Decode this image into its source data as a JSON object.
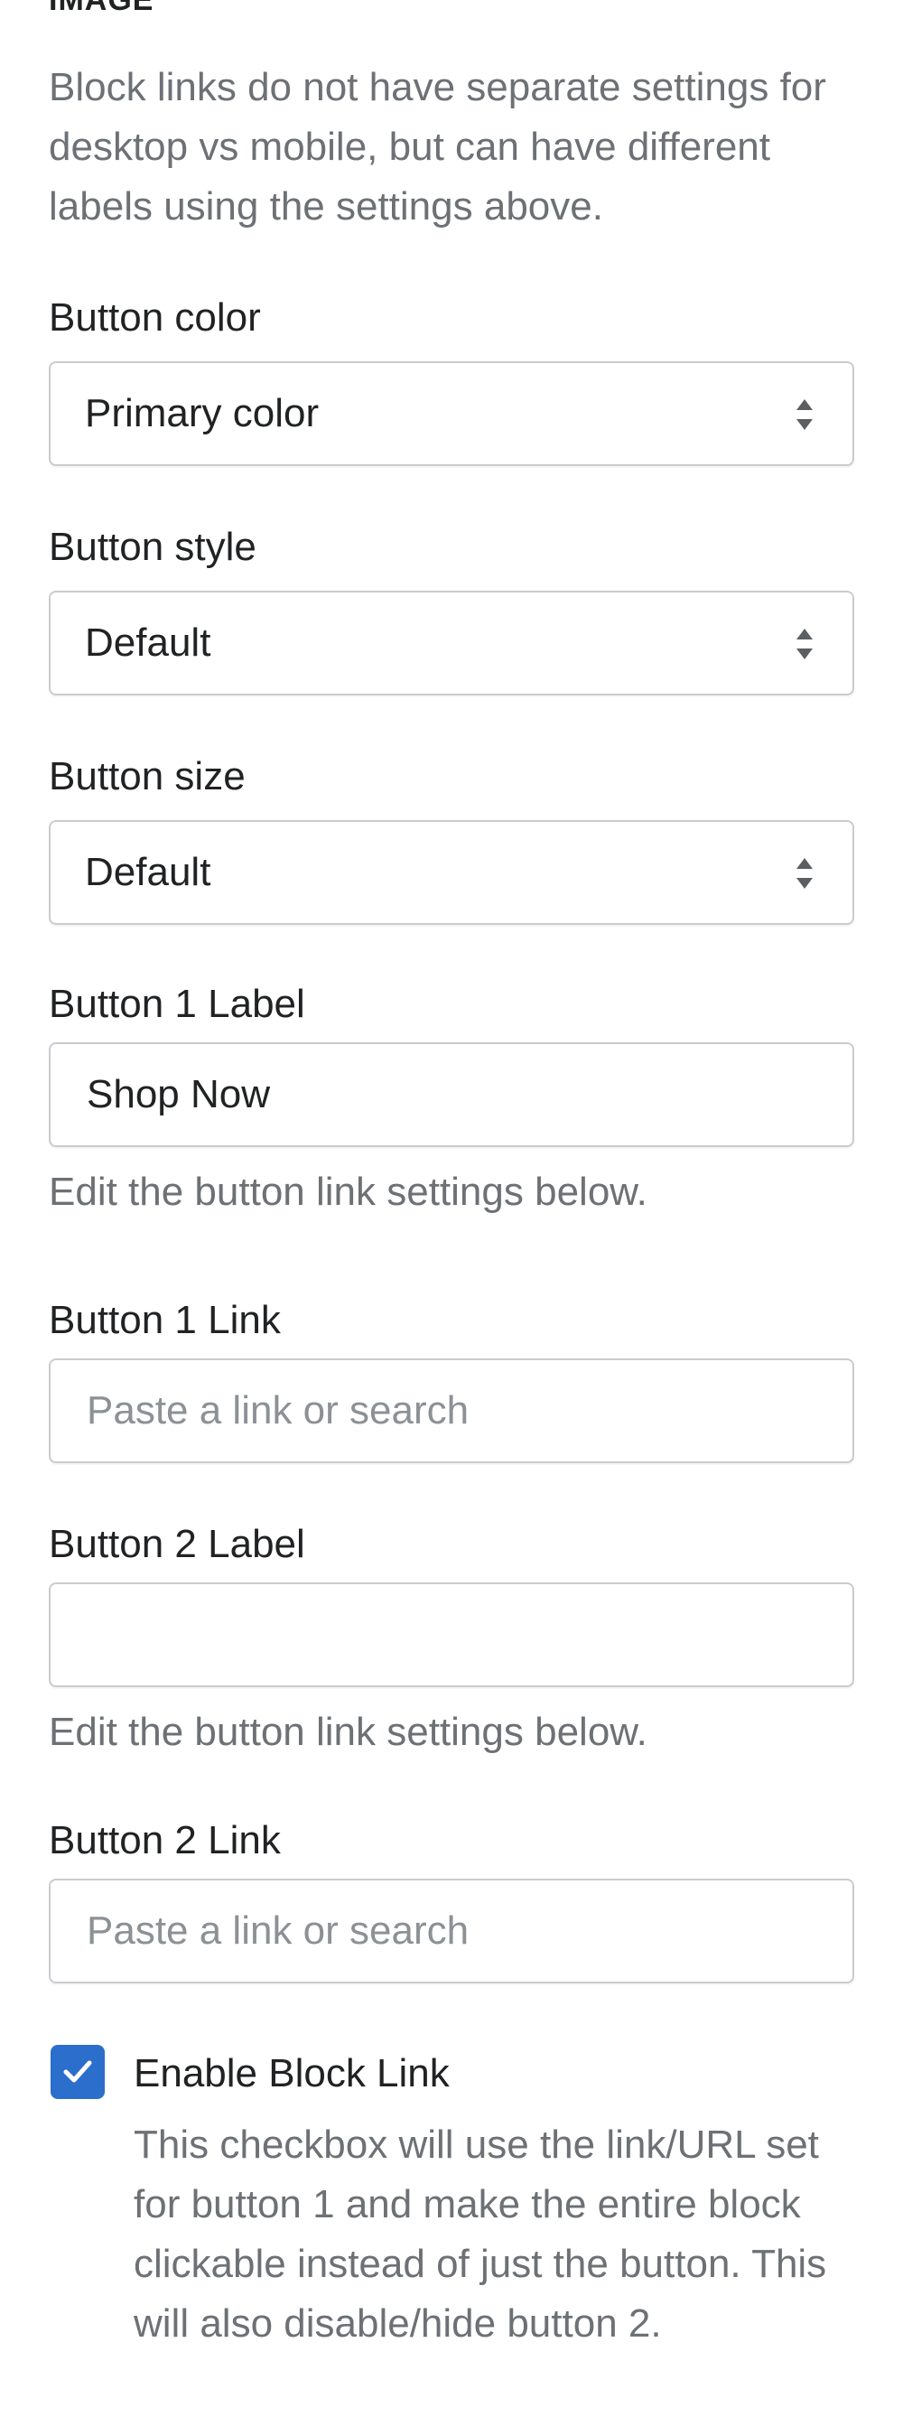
{
  "section": {
    "heading": "IMAGE",
    "intro": "Block links do not have separate settings for desktop vs mobile, but can have different labels using the settings above."
  },
  "button_color": {
    "label": "Button color",
    "value": "Primary color"
  },
  "button_style": {
    "label": "Button style",
    "value": "Default"
  },
  "button_size": {
    "label": "Button size",
    "value": "Default"
  },
  "button1_label": {
    "label": "Button 1 Label",
    "value": "Shop Now",
    "help": "Edit the button link settings below."
  },
  "button1_link": {
    "label": "Button 1 Link",
    "placeholder": "Paste a link or search"
  },
  "button2_label": {
    "label": "Button 2 Label",
    "value": "",
    "help": "Edit the button link settings below."
  },
  "button2_link": {
    "label": "Button 2 Link",
    "placeholder": "Paste a link or search"
  },
  "block_link": {
    "label": "Enable Block Link",
    "checked": true,
    "help": "This checkbox will use the link/URL set for button 1 and make the entire block clickable instead of just the button. This will also disable/hide button 2."
  },
  "colors": {
    "accent": "#2c6ecb",
    "text": "#202223",
    "subdued": "#6d7175",
    "border": "#c9cccf"
  },
  "icons": {
    "select": "select-arrows-icon",
    "check": "checkmark-icon"
  }
}
